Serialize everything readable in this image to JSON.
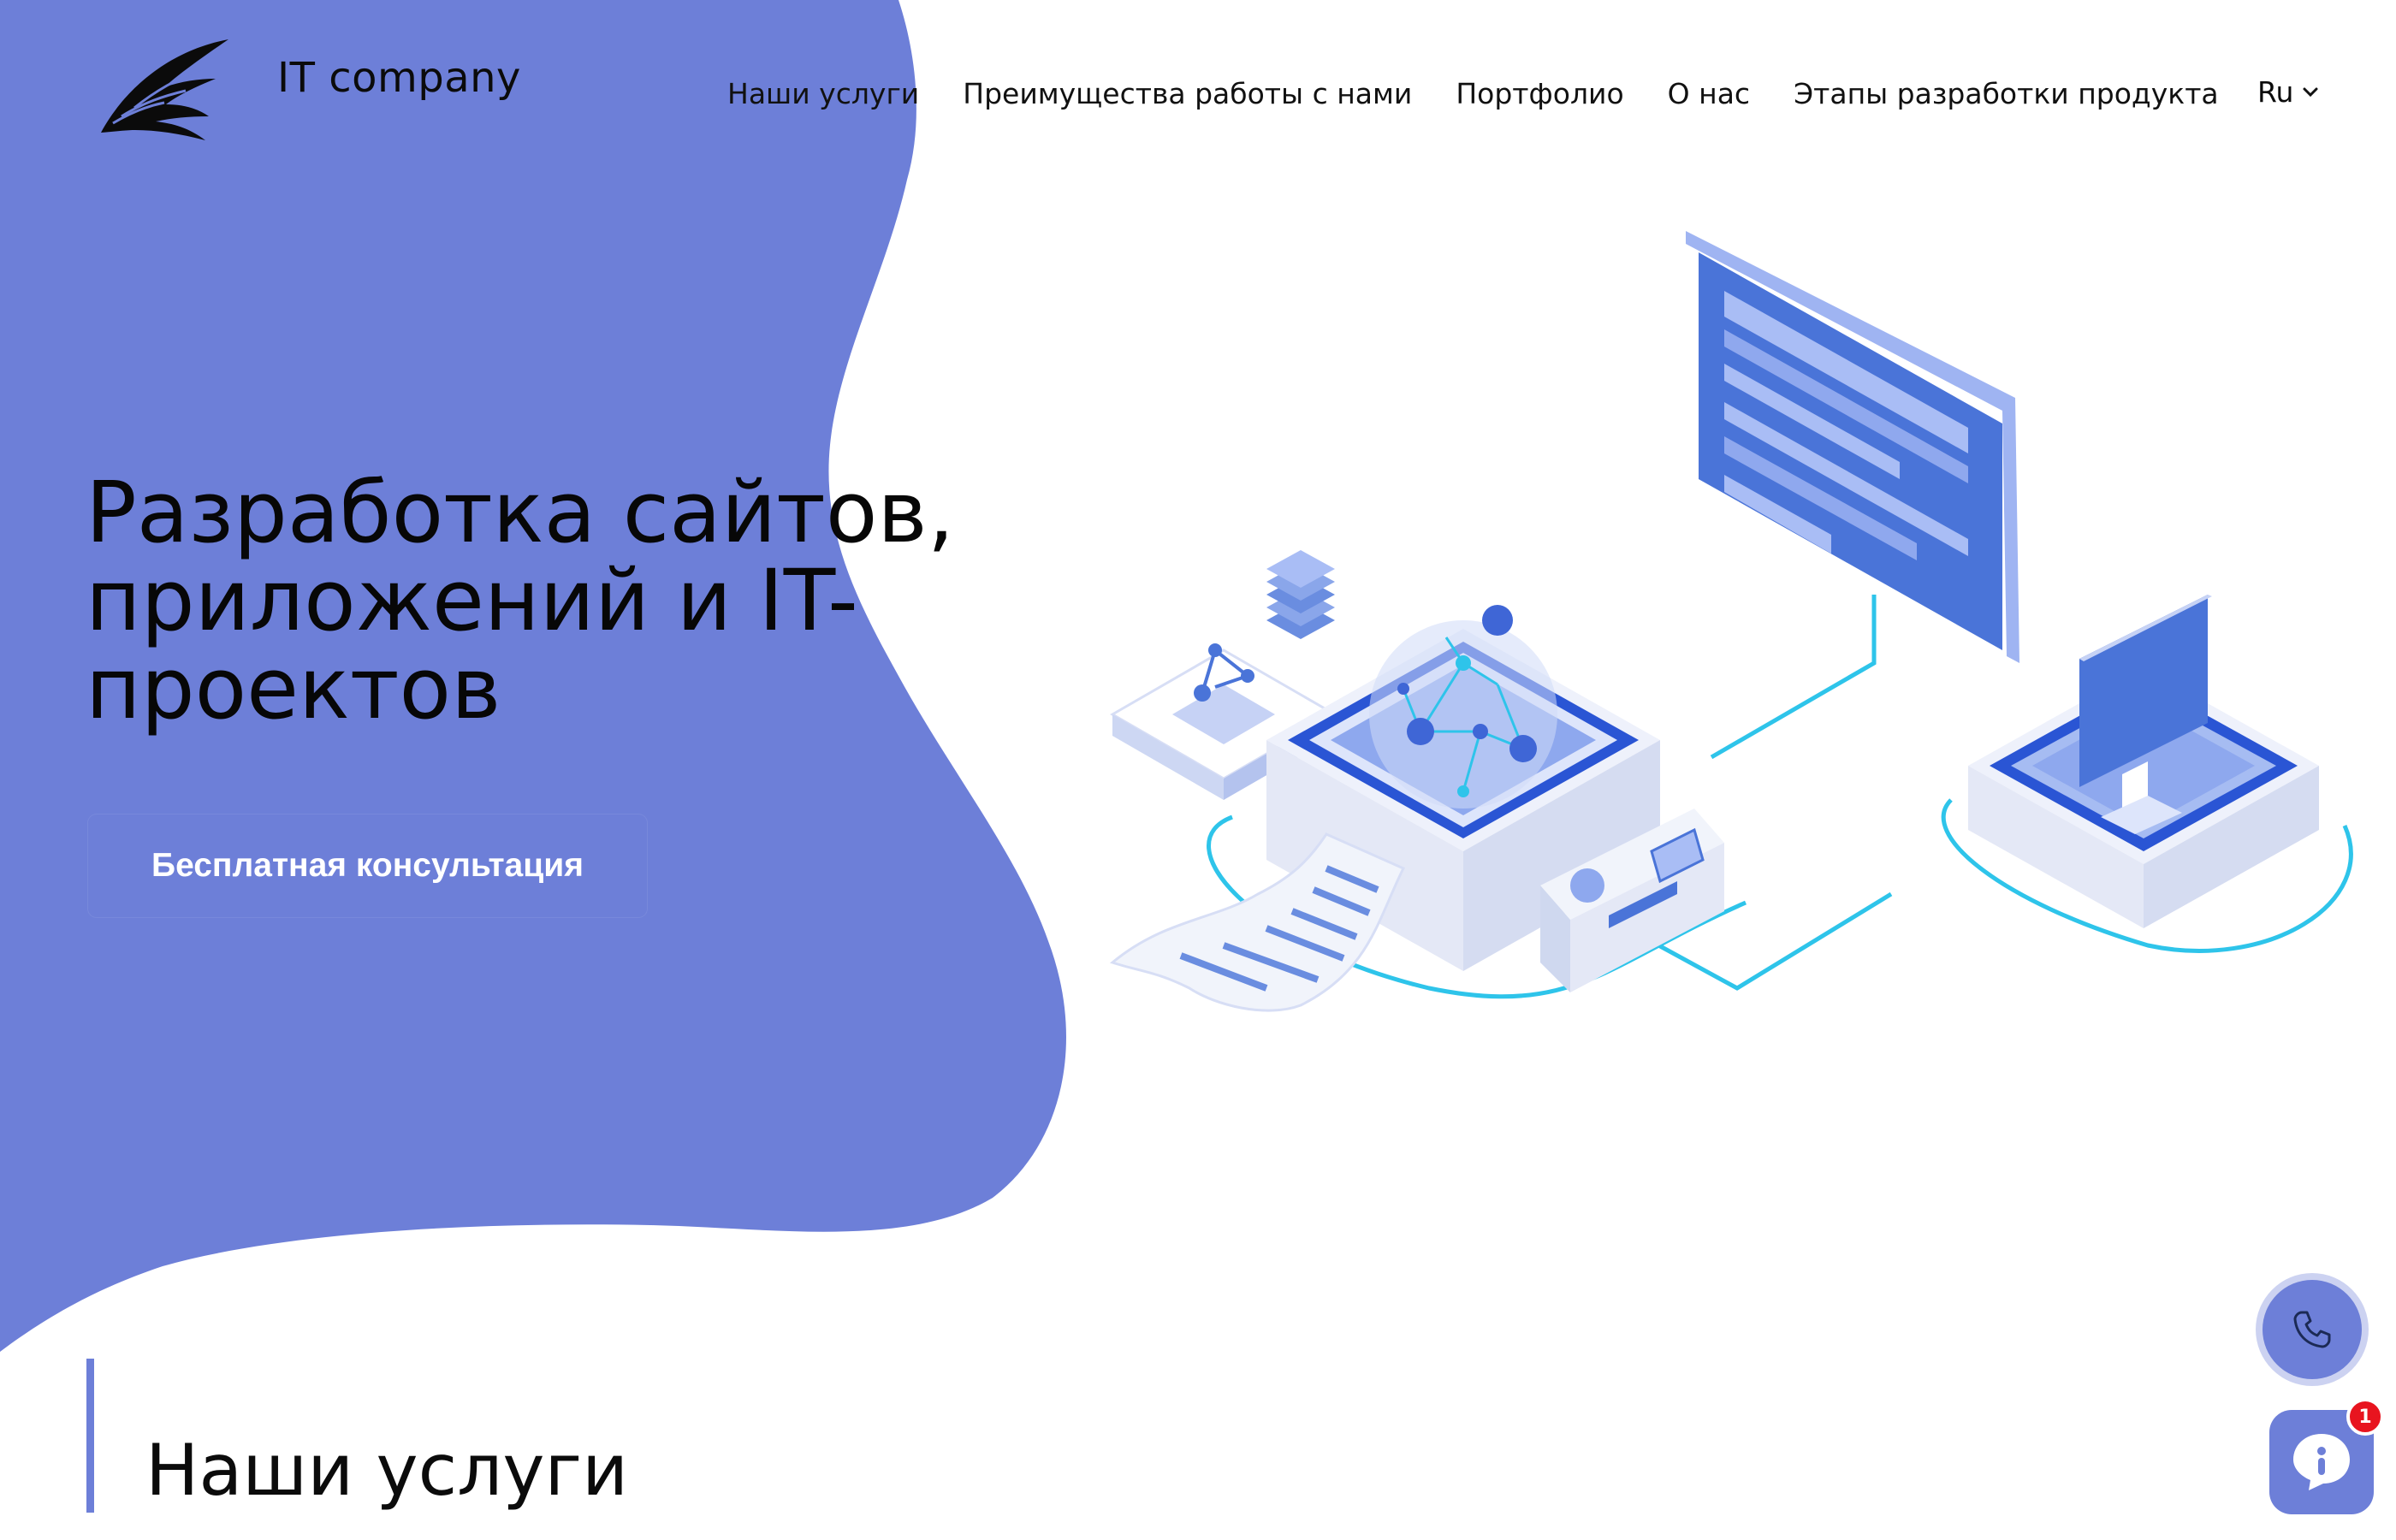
{
  "brand": {
    "name": "IT company",
    "logo_icon": "eagle-wing-logo"
  },
  "nav": {
    "items": [
      {
        "label": "Наши услуги"
      },
      {
        "label": "Преимущества работы с нами"
      },
      {
        "label": "Портфолио"
      },
      {
        "label": "О нас"
      },
      {
        "label": "Этапы разработки продукта"
      }
    ],
    "language": "Ru"
  },
  "hero": {
    "title_lines": [
      "Разработка сайтов,",
      "приложений и IT-",
      "проектов"
    ],
    "cta_label": "Бесплатная консультация"
  },
  "services": {
    "title": "Наши услуги"
  },
  "widgets": {
    "call_icon": "phone-icon",
    "chat_icon": "chat-bubble-icon",
    "chat_badge_count": "1"
  },
  "colors": {
    "accent": "#6d7fd8",
    "illustration_blue": "#4a74d8",
    "illustration_cyan": "#2ec4ea",
    "badge_red": "#e8141f"
  }
}
